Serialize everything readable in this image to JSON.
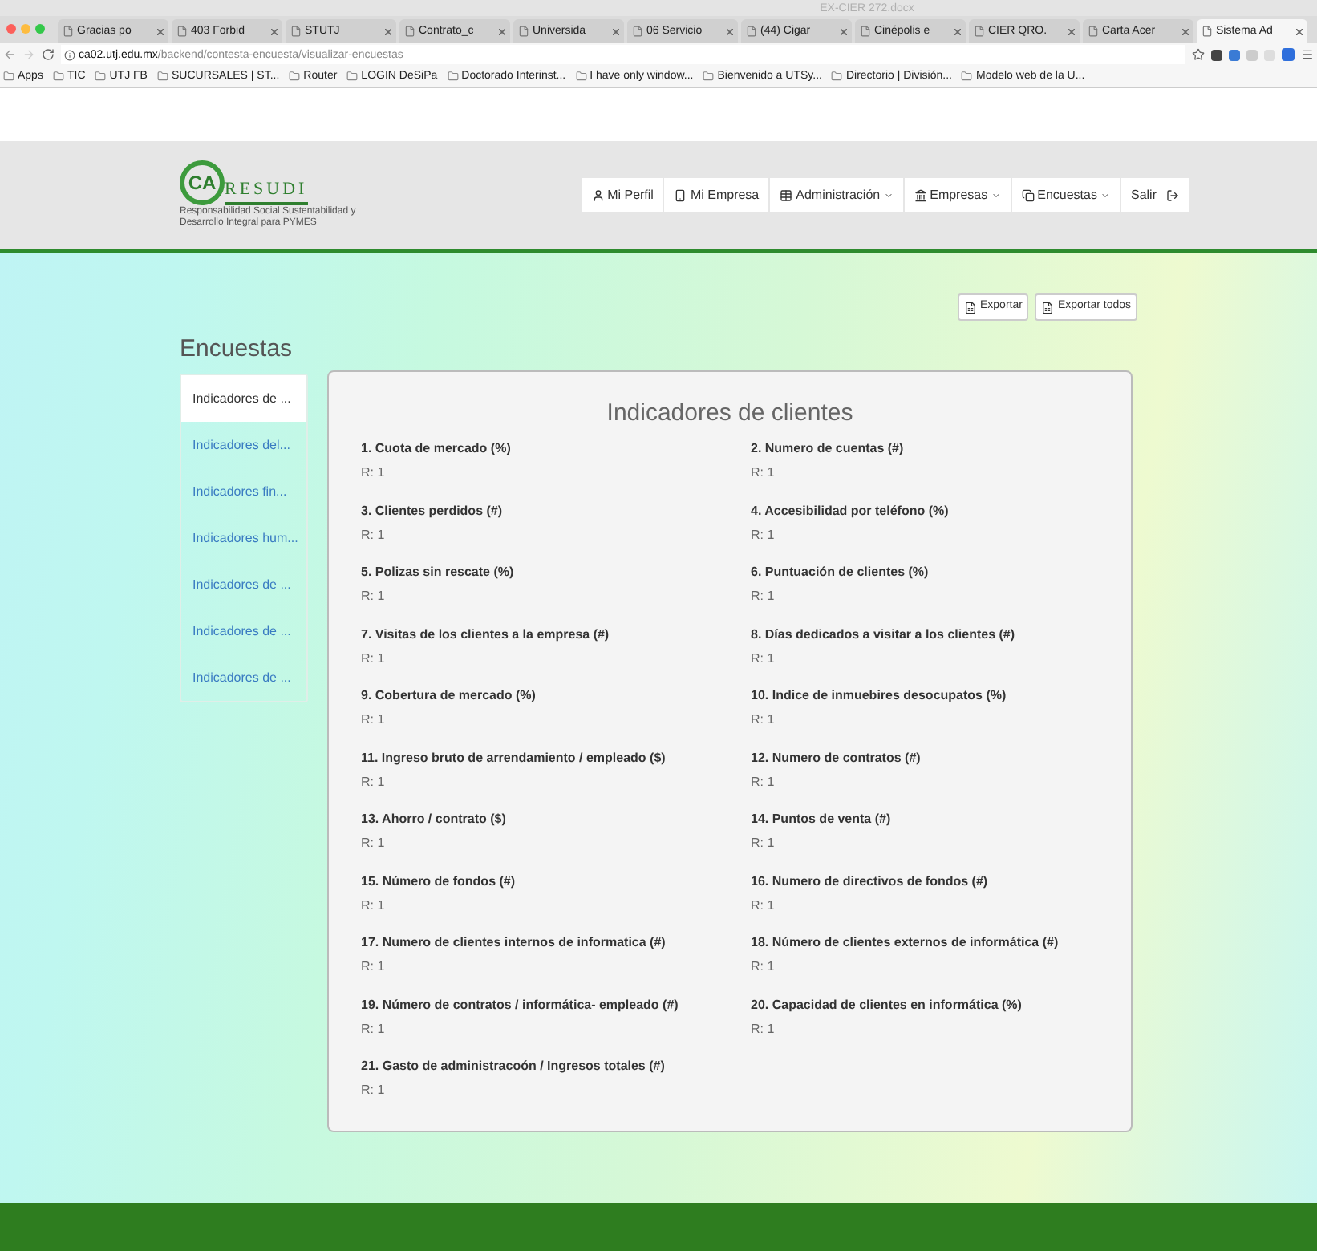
{
  "window": {
    "title": "EX-CIER 272.docx"
  },
  "tabs": [
    {
      "label": "Gracias po",
      "selected": false
    },
    {
      "label": "403 Forbid",
      "selected": false
    },
    {
      "label": "STUTJ",
      "selected": false
    },
    {
      "label": "Contrato_c",
      "selected": false
    },
    {
      "label": "Universida",
      "selected": false
    },
    {
      "label": "06 Servicio",
      "selected": false
    },
    {
      "label": "(44) Cigar",
      "selected": false
    },
    {
      "label": "Cinépolis e",
      "selected": false
    },
    {
      "label": "CIER QRO.",
      "selected": false
    },
    {
      "label": "Carta Acer",
      "selected": false
    },
    {
      "label": "Sistema Ad",
      "selected": true
    }
  ],
  "address": {
    "host": "ca02.utj.edu.mx",
    "path": "/backend/contesta-encuesta/visualizar-encuestas"
  },
  "bookmarks": [
    "Apps",
    "TIC",
    "UTJ FB",
    "SUCURSALES | ST...",
    "Router",
    "LOGIN DeSiPa",
    "Doctorado Interinst...",
    "I have only window...",
    "Bienvenido a UTSy...",
    "Directorio | División...",
    "Modelo web de la U..."
  ],
  "logo": {
    "initials": "CA",
    "name": "RESUDI",
    "tagline": "Responsabilidad Social Sustentabilidad y Desarrollo Integral para PYMES"
  },
  "nav": [
    {
      "label": "Mi Perfil",
      "kind": "user",
      "dropdown": false
    },
    {
      "label": "Mi Empresa",
      "kind": "phone",
      "dropdown": false
    },
    {
      "label": "Administración",
      "kind": "table",
      "dropdown": true
    },
    {
      "label": "Empresas",
      "kind": "bank",
      "dropdown": true
    },
    {
      "label": "Encuestas",
      "kind": "copy",
      "dropdown": true
    },
    {
      "label": "Salir",
      "kind": "logout",
      "dropdown": false
    }
  ],
  "actions": [
    "Exportar",
    "Exportar todos"
  ],
  "sidebar": {
    "title": "Encuestas",
    "items": [
      {
        "label": "Indicadores de ...",
        "selected": true
      },
      {
        "label": "Indicadores del...",
        "selected": false
      },
      {
        "label": "Indicadores fin...",
        "selected": false
      },
      {
        "label": "Indicadores hum...",
        "selected": false
      },
      {
        "label": "Indicadores de ...",
        "selected": false
      },
      {
        "label": "Indicadores de ...",
        "selected": false
      },
      {
        "label": "Indicadores de ...",
        "selected": false
      }
    ]
  },
  "survey": {
    "title": "Indicadores de clientes",
    "questions": [
      {
        "question": "1. Cuota de mercado (%)",
        "answer": "R: 1"
      },
      {
        "question": "2. Numero de cuentas (#)",
        "answer": "R: 1"
      },
      {
        "question": "3. Clientes perdidos (#)",
        "answer": "R: 1"
      },
      {
        "question": "4. Accesibilidad por teléfono (%)",
        "answer": "R: 1"
      },
      {
        "question": "5. Polizas sin rescate (%)",
        "answer": "R: 1"
      },
      {
        "question": "6. Puntuación de clientes (%)",
        "answer": "R: 1"
      },
      {
        "question": "7. Visitas de los clientes a la empresa (#)",
        "answer": "R: 1"
      },
      {
        "question": "8. Días dedicados a visitar a los clientes (#)",
        "answer": "R: 1"
      },
      {
        "question": "9. Cobertura de mercado (%)",
        "answer": "R: 1"
      },
      {
        "question": "10. Indice de inmuebires desocupatos (%)",
        "answer": "R: 1"
      },
      {
        "question": "11. Ingreso bruto de arrendamiento / empleado ($)",
        "answer": "R: 1"
      },
      {
        "question": "12. Numero de contratos (#)",
        "answer": "R: 1"
      },
      {
        "question": "13. Ahorro / contrato ($)",
        "answer": "R: 1"
      },
      {
        "question": "14. Puntos de venta (#)",
        "answer": "R: 1"
      },
      {
        "question": "15. Número de fondos (#)",
        "answer": "R: 1"
      },
      {
        "question": "16. Numero de directivos de fondos (#)",
        "answer": "R: 1"
      },
      {
        "question": "17. Numero de clientes internos de informatica (#)",
        "answer": "R: 1"
      },
      {
        "question": "18. Número de clientes externos de informática (#)",
        "answer": "R: 1"
      },
      {
        "question": "19. Número de contratos / informática- empleado (#)",
        "answer": "R: 1"
      },
      {
        "question": "20. Capacidad de clientes en informática (%)",
        "answer": "R: 1"
      },
      {
        "question": "21. Gasto de administracoón / Ingresos totales (#)",
        "answer": "R: 1"
      }
    ]
  }
}
